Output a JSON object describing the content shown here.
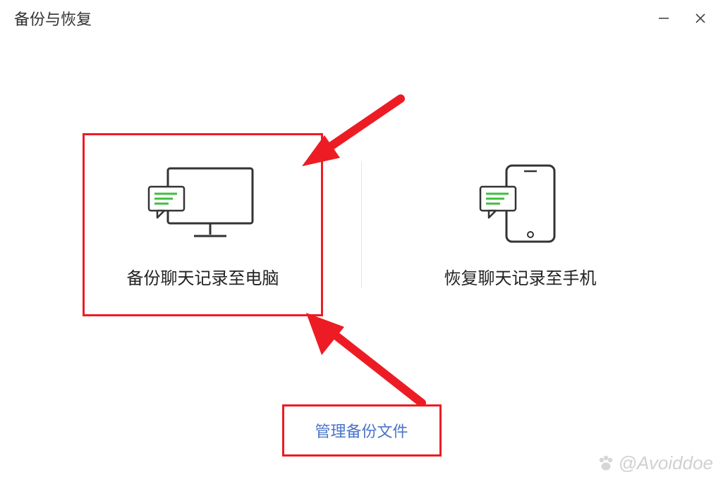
{
  "window": {
    "title": "备份与恢复"
  },
  "options": {
    "backup_to_pc": "备份聊天记录至电脑",
    "restore_to_phone": "恢复聊天记录至手机"
  },
  "manage_button": "管理备份文件",
  "watermark": "@Avoiddoe",
  "colors": {
    "highlight": "#ed1c24",
    "link": "#4a74c9",
    "icon_accent": "#3fbf3f"
  }
}
